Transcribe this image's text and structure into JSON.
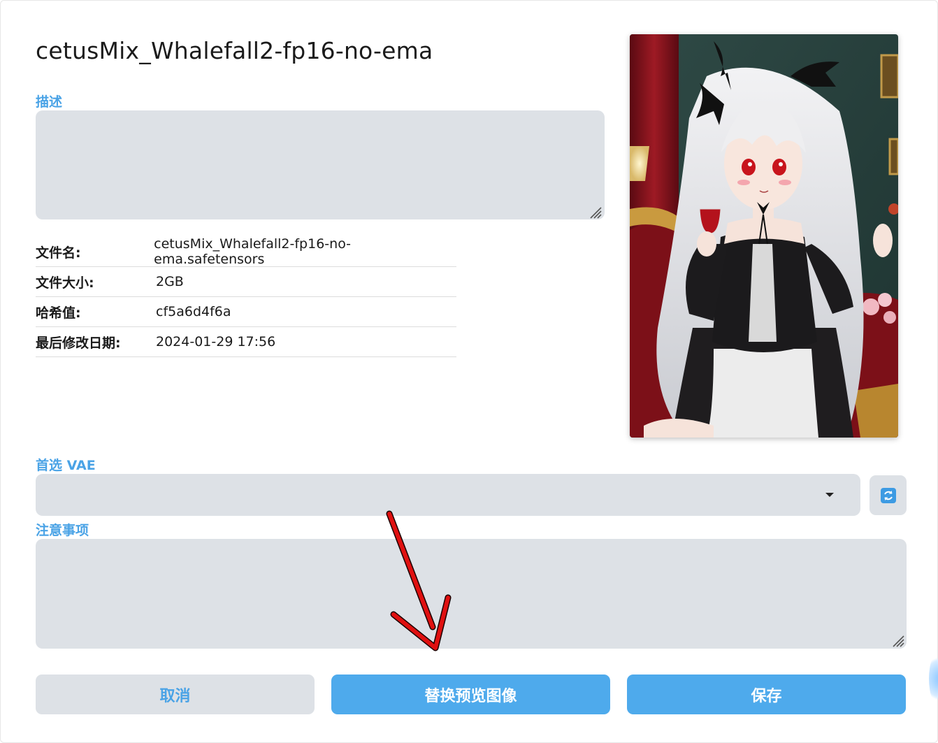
{
  "title": "cetusMix_Whalefall2-fp16-no-ema",
  "description": {
    "label": "描述",
    "value": ""
  },
  "info": [
    {
      "key": "文件名:",
      "value": "cetusMix_Whalefall2-fp16-no-ema.safetensors"
    },
    {
      "key": "文件大小:",
      "value": "2GB"
    },
    {
      "key": "哈希值:",
      "value": "cf5a6d4f6a"
    },
    {
      "key": "最后修改日期:",
      "value": "2024-01-29 17:56"
    }
  ],
  "vae": {
    "label": "首选 VAE",
    "selected": ""
  },
  "notes": {
    "label": "注意事项",
    "value": ""
  },
  "buttons": {
    "cancel": "取消",
    "replace_preview": "替换预览图像",
    "save": "保存"
  },
  "colors": {
    "accent": "#4eaaec",
    "label_blue": "#4aa3e6",
    "field_bg": "#dde1e6",
    "annotation_arrow": "#e01010"
  },
  "icons": {
    "refresh": "refresh-icon",
    "dropdown": "chevron-down-icon"
  }
}
